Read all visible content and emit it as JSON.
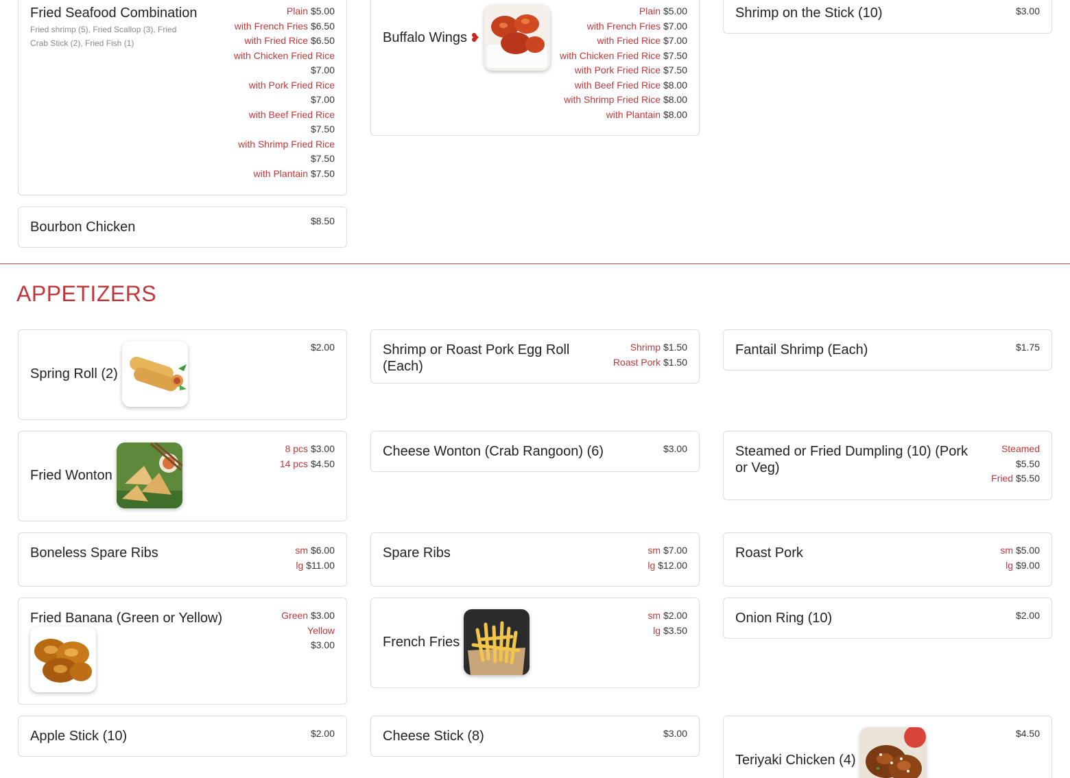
{
  "section": {
    "title": "APPETIZERS"
  },
  "cards": {
    "fried_seafood": {
      "name": "Fried Seafood Combination",
      "desc": "Fried shrimp (5), Fried Scallop (3), Fried Crab Stick (2), Fried Fish (1)",
      "prices": [
        {
          "label": "Plain",
          "price": "$5.00"
        },
        {
          "label": "with French Fries",
          "price": "$6.50"
        },
        {
          "label": "with Fried Rice",
          "price": "$6.50"
        },
        {
          "label": "with Chicken Fried Rice",
          "price": "$7.00"
        },
        {
          "label": "with Pork Fried Rice",
          "price": "$7.00"
        },
        {
          "label": "with Beef Fried Rice",
          "price": "$7.50"
        },
        {
          "label": "with Shrimp Fried Rice",
          "price": "$7.50"
        },
        {
          "label": "with Plantain",
          "price": "$7.50"
        }
      ]
    },
    "buffalo_wings": {
      "name": "Buffalo Wings",
      "prices": [
        {
          "label": "Plain",
          "price": "$5.00"
        },
        {
          "label": "with French Fries",
          "price": "$7.00"
        },
        {
          "label": "with Fried Rice",
          "price": "$7.00"
        },
        {
          "label": "with Chicken Fried Rice",
          "price": "$7.50"
        },
        {
          "label": "with Pork Fried Rice",
          "price": "$7.50"
        },
        {
          "label": "with Beef Fried Rice",
          "price": "$8.00"
        },
        {
          "label": "with Shrimp Fried Rice",
          "price": "$8.00"
        },
        {
          "label": "with Plantain",
          "price": "$8.00"
        }
      ]
    },
    "shrimp_stick": {
      "name": "Shrimp on the Stick (10)",
      "price": "$3.00"
    },
    "bourbon": {
      "name": "Bourbon Chicken",
      "price": "$8.50"
    },
    "spring_roll": {
      "name": "Spring Roll (2)",
      "price": "$2.00"
    },
    "egg_roll": {
      "name": "Shrimp or Roast Pork Egg Roll (Each)",
      "prices": [
        {
          "label": "Shrimp",
          "price": "$1.50"
        },
        {
          "label": "Roast Pork",
          "price": "$1.50"
        }
      ]
    },
    "fantail": {
      "name": "Fantail Shrimp (Each)",
      "price": "$1.75"
    },
    "fried_wonton": {
      "name": "Fried Wonton",
      "prices": [
        {
          "label": "8 pcs",
          "price": "$3.00"
        },
        {
          "label": "14 pcs",
          "price": "$4.50"
        }
      ]
    },
    "cheese_wonton": {
      "name": "Cheese Wonton (Crab Rangoon) (6)",
      "price": "$3.00"
    },
    "dumpling": {
      "name": "Steamed or Fried Dumpling (10) (Pork or Veg)",
      "prices": [
        {
          "label": "Steamed",
          "price": "$5.50"
        },
        {
          "label": "Fried",
          "price": "$5.50"
        }
      ]
    },
    "boneless_ribs": {
      "name": "Boneless Spare Ribs",
      "prices": [
        {
          "label": "sm",
          "price": "$6.00"
        },
        {
          "label": "lg",
          "price": "$11.00"
        }
      ]
    },
    "spare_ribs": {
      "name": "Spare Ribs",
      "prices": [
        {
          "label": "sm",
          "price": "$7.00"
        },
        {
          "label": "lg",
          "price": "$12.00"
        }
      ]
    },
    "roast_pork": {
      "name": "Roast Pork",
      "prices": [
        {
          "label": "sm",
          "price": "$5.00"
        },
        {
          "label": "lg",
          "price": "$9.00"
        }
      ]
    },
    "fried_banana": {
      "name": "Fried Banana (Green or Yellow)",
      "prices": [
        {
          "label": "Green",
          "price": "$3.00"
        },
        {
          "label": "Yellow",
          "price": "$3.00"
        }
      ]
    },
    "french_fries": {
      "name": "French Fries",
      "prices": [
        {
          "label": "sm",
          "price": "$2.00"
        },
        {
          "label": "lg",
          "price": "$3.50"
        }
      ]
    },
    "onion_ring": {
      "name": "Onion Ring (10)",
      "price": "$2.00"
    },
    "apple_stick": {
      "name": "Apple Stick (10)",
      "price": "$2.00"
    },
    "cheese_stick": {
      "name": "Cheese Stick (8)",
      "price": "$3.00"
    },
    "teriyaki": {
      "name": "Teriyaki Chicken (4)",
      "price": "$4.50"
    }
  },
  "colors": {
    "accent": "#c0373a",
    "border": "#dcdcdc"
  },
  "icons": {
    "spicy": "chili-pepper-icon"
  }
}
